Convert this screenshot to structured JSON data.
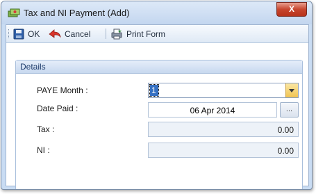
{
  "window": {
    "title": "Tax and NI Payment (Add)",
    "close_label": "X"
  },
  "toolbar": {
    "ok_label": "OK",
    "cancel_label": "Cancel",
    "print_label": "Print Form"
  },
  "details": {
    "header": "Details",
    "paye_month_label": "PAYE Month :",
    "paye_month_value": "1",
    "date_paid_label": "Date Paid :",
    "date_paid_value": "06 Apr 2014",
    "date_button_label": "...",
    "tax_label": "Tax :",
    "tax_value": "0.00",
    "ni_label": "NI :",
    "ni_value": "0.00"
  },
  "colors": {
    "accent": "#3570c2",
    "dropdown_button": "#f1c452",
    "close_button": "#c7462e"
  }
}
